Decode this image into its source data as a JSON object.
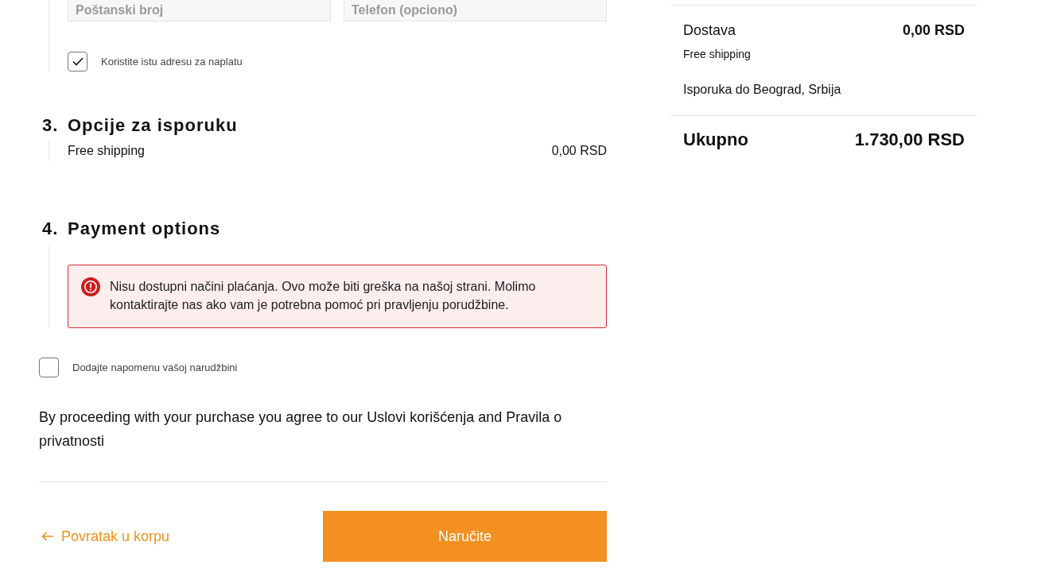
{
  "address_section": {
    "fields": [
      {
        "placeholder": "Poštanski broj"
      },
      {
        "placeholder": "Telefon (opciono)"
      }
    ],
    "same_billing": {
      "label": "Koristite istu adresu za naplatu",
      "checked": true
    }
  },
  "delivery_section": {
    "number": "3.",
    "title": "Opcije za isporuku",
    "options": [
      {
        "label": "Free shipping",
        "price": "0,00 RSD"
      }
    ]
  },
  "payment_section": {
    "number": "4.",
    "title": "Payment options",
    "alert": {
      "message": "Nisu dostupni načini plaćanja. Ovo može biti greška na našoj strani. Molimo kontaktirajte nas ako vam je potrebna pomoć pri pravljenju porudžbine."
    }
  },
  "order_note": {
    "label": "Dodajte napomenu vašoj narudžbini",
    "checked": false
  },
  "terms": "By proceeding with your purchase you agree to our Uslovi korišćenja and Pravila o privatnosti",
  "back_link": "Povratak u korpu",
  "submit_button": "Naručite",
  "summary": {
    "shipping": {
      "label": "Dostava",
      "value": "0,00 RSD",
      "method": "Free shipping",
      "destination": "Isporuka do Beograd, Srbija"
    },
    "total": {
      "label": "Ukupno",
      "value": "1.730,00 RSD"
    }
  }
}
